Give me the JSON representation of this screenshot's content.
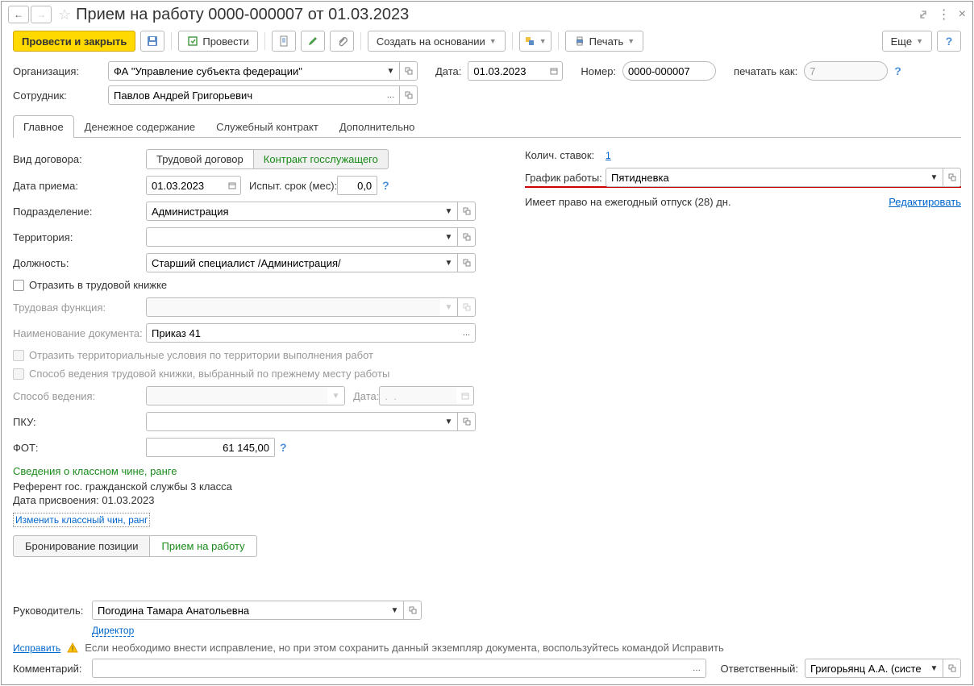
{
  "window": {
    "title": "Прием на работу 0000-000007 от 01.03.2023"
  },
  "toolbar": {
    "submit_close": "Провести и закрыть",
    "submit": "Провести",
    "create_based": "Создать на основании",
    "print": "Печать",
    "more": "Еще"
  },
  "header": {
    "org_label": "Организация:",
    "org_value": "ФА \"Управление субъекта федерации\"",
    "date_label": "Дата:",
    "date_value": "01.03.2023",
    "num_label": "Номер:",
    "num_value": "0000-000007",
    "print_as_label": "печатать как:",
    "print_as_value": "7",
    "emp_label": "Сотрудник:",
    "emp_value": "Павлов Андрей Григорьевич"
  },
  "tabs": [
    "Главное",
    "Денежное содержание",
    "Служебный контракт",
    "Дополнительно"
  ],
  "main": {
    "contract_type_label": "Вид договора:",
    "contract_type_opts": [
      "Трудовой договор",
      "Контракт госслужащего"
    ],
    "hire_date_label": "Дата приема:",
    "hire_date_value": "01.03.2023",
    "probation_label": "Испыт. срок (мес):",
    "probation_value": "0,0",
    "dept_label": "Подразделение:",
    "dept_value": "Администрация",
    "territory_label": "Территория:",
    "territory_value": "",
    "position_label": "Должность:",
    "position_value": "Старший специалист /Администрация/",
    "reflect_workbook": "Отразить в трудовой книжке",
    "labor_func_label": "Трудовая функция:",
    "docname_label": "Наименование документа:",
    "docname_value": "Приказ 41",
    "reflect_territory": "Отразить территориальные условия по территории выполнения работ",
    "workbook_method": "Способ ведения трудовой книжки, выбранный по прежнему месту работы",
    "method_label": "Способ ведения:",
    "method_date_label": "Дата:",
    "method_date_value": ".  .",
    "pku_label": "ПКУ:",
    "fot_label": "ФОТ:",
    "fot_value": "61 145,00",
    "rank_section": "Сведения о классном чине, ранге",
    "rank_text1": "Референт гос. гражданской службы 3 класса",
    "rank_text2": "Дата присвоения: 01.03.2023",
    "rank_link": "Изменить клaссный чин, ранг",
    "action_booking": "Бронирование позиции",
    "action_hire": "Прием на работу"
  },
  "right": {
    "rates_label": "Колич. ставок:",
    "rates_value": "1",
    "schedule_label": "График работы:",
    "schedule_value": "Пятидневка",
    "vacation_text": "Имеет право на ежегодный отпуск (28) дн.",
    "edit_link": "Редактировать"
  },
  "footer": {
    "manager_label": "Руководитель:",
    "manager_value": "Погодина Тамара Анатольевна",
    "director_link": "Директор",
    "fix_link": "Исправить",
    "fix_text": "Если необходимо внести исправление, но при этом сохранить данный экземпляр документа, воспользуйтесь командой Исправить",
    "comment_label": "Комментарий:",
    "responsible_label": "Ответственный:",
    "responsible_value": "Григорьянц А.А. (системн"
  }
}
